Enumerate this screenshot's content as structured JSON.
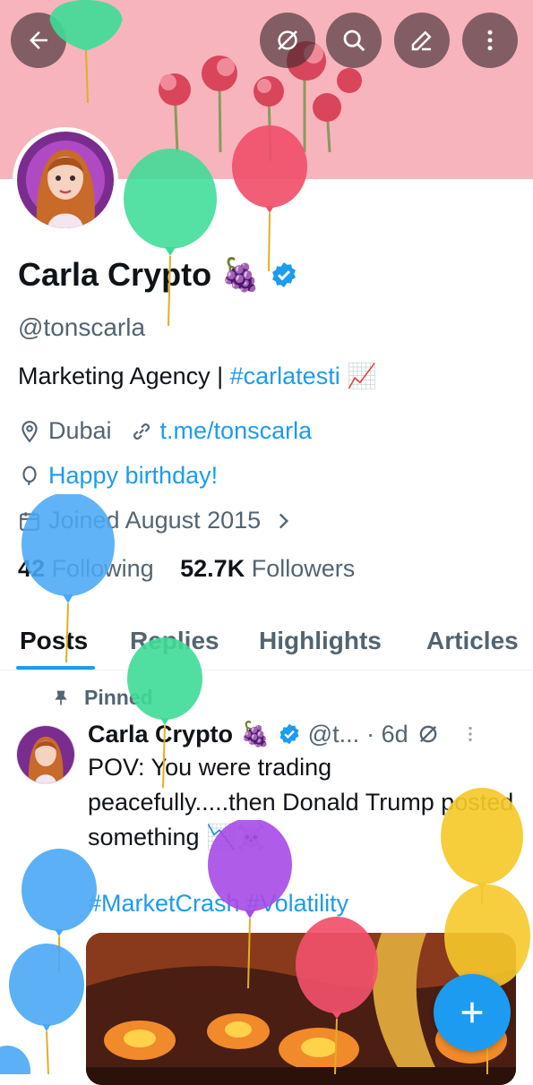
{
  "header": {
    "back_icon": "arrow-left-icon",
    "actions": [
      "grok-icon",
      "search-icon",
      "edit-icon",
      "more-vertical-icon"
    ]
  },
  "profile": {
    "name": "Carla Crypto",
    "name_emoji": "🍇",
    "handle": "@tonscarla",
    "bio_prefix": "Marketing Agency | ",
    "bio_hashtag": "#carlatesti",
    "bio_emoji": "📈",
    "location": "Dubai",
    "website": "t.me/tonscarla",
    "birthday": "Happy birthday!",
    "joined": "Joined August 2015",
    "following_count": "42",
    "following_label": "Following",
    "followers_count": "52.7K",
    "followers_label": "Followers"
  },
  "tabs": [
    {
      "label": "Posts"
    },
    {
      "label": "Replies"
    },
    {
      "label": "Highlights"
    },
    {
      "label": "Articles"
    }
  ],
  "post": {
    "pinned_label": "Pinned",
    "author": "Carla Crypto",
    "author_emoji": "🍇",
    "handle": "@t...",
    "time": "· 6d",
    "text": "POV: You were trading peacefully.....then Donald Trump posted something 📉☠️",
    "hashtags": "#MarketCrash #Volatility"
  },
  "colors": {
    "accent": "#1d9bf0",
    "banner": "#f8b4bd",
    "text": "#0f1419",
    "muted": "#536471"
  },
  "fab": {
    "icon": "plus-icon"
  }
}
